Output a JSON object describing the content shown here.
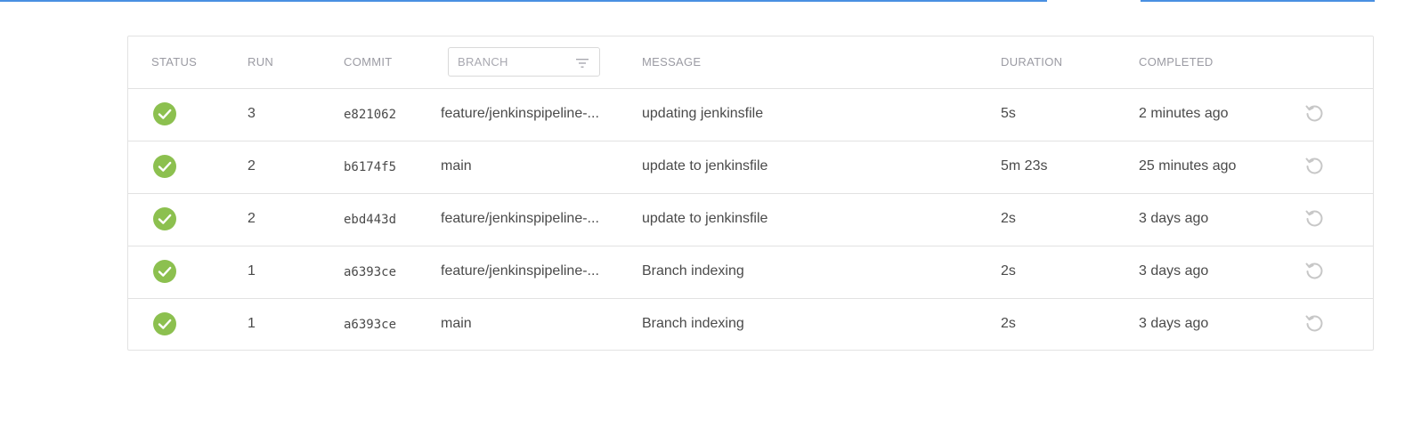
{
  "colors": {
    "accent": "#4a90e2",
    "success": "#8cc04f",
    "header_text": "#9b9ba3",
    "body_text": "#4a4a4a",
    "icon_muted": "#c7c7c7"
  },
  "table": {
    "headers": {
      "status": "STATUS",
      "run": "RUN",
      "commit": "COMMIT",
      "branch_filter_placeholder": "BRANCH",
      "message": "MESSAGE",
      "duration": "DURATION",
      "completed": "COMPLETED"
    },
    "rows": [
      {
        "status": "success",
        "status_icon": "check-circle-icon",
        "run": "3",
        "commit": "e821062",
        "branch": "feature/jenkinspipeline-...",
        "message": "updating jenkinsfile",
        "duration": "5s",
        "completed": "2 minutes ago",
        "action_icon": "rerun-icon"
      },
      {
        "status": "success",
        "status_icon": "check-circle-icon",
        "run": "2",
        "commit": "b6174f5",
        "branch": "main",
        "message": "update to jenkinsfile",
        "duration": "5m 23s",
        "completed": "25 minutes ago",
        "action_icon": "rerun-icon"
      },
      {
        "status": "success",
        "status_icon": "check-circle-icon",
        "run": "2",
        "commit": "ebd443d",
        "branch": "feature/jenkinspipeline-...",
        "message": "update to jenkinsfile",
        "duration": "2s",
        "completed": "3 days ago",
        "action_icon": "rerun-icon"
      },
      {
        "status": "success",
        "status_icon": "check-circle-icon",
        "run": "1",
        "commit": "a6393ce",
        "branch": "feature/jenkinspipeline-...",
        "message": "Branch indexing",
        "duration": "2s",
        "completed": "3 days ago",
        "action_icon": "rerun-icon"
      },
      {
        "status": "success",
        "status_icon": "check-circle-icon",
        "run": "1",
        "commit": "a6393ce",
        "branch": "main",
        "message": "Branch indexing",
        "duration": "2s",
        "completed": "3 days ago",
        "action_icon": "rerun-icon"
      }
    ]
  }
}
